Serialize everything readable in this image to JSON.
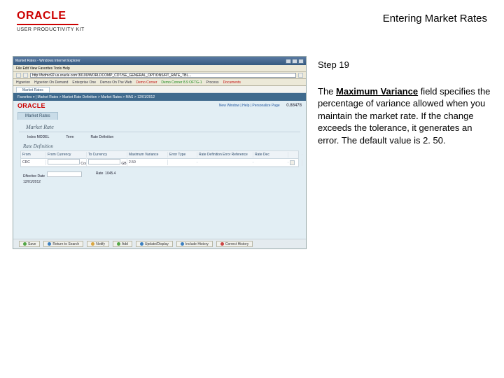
{
  "header": {
    "logo_text": "ORACLE",
    "upk_text": "USER PRODUCTIVITY KIT",
    "doc_title": "Entering Market Rates"
  },
  "info": {
    "step_label": "Step 19",
    "bold_term": "Maximum Variance",
    "text_before": "The ",
    "text_after": " field specifies the percentage of variance allowed when you maintain the market rate. If the change exceeds the tolerance, it generates an error. The default value is 2. 50."
  },
  "screenshot": {
    "window_title": "Market Rates - Windows Internet Explorer",
    "menu": "File  Edit  View  Favorites  Tools  Help",
    "address": "http://fsdmo92.us.oracle.com:30100/WORLDCOMP_CDT/SE_GENERAL_OPTIONS/RT_RATE_TBL...",
    "toolbar_items": [
      "Hyperion",
      "Hyperion On Demand",
      "Enterprise One",
      "Demos On The Web",
      "Demo Corner",
      "Demo Corner 8.9 OFTG-1",
      "Process",
      "Documents"
    ],
    "tab_label": "Market Rates",
    "crumb": "Favorites ▾ | Market Rates > Market Rate Definition > Market Rates > MAS > 12/01/2012",
    "oracle_word": "ORACLE",
    "header_links": "New Window | Help | Personalize Page",
    "top_right_val": "0.88478",
    "sub_tab": "Market Rates",
    "panel_title": "Market Rate",
    "fields": {
      "index_label": "Index",
      "index_val": "MODEL",
      "term_label": "Term",
      "term_val": "",
      "rate_type_label": "Rate Definition"
    },
    "section_title": "Rate Definition",
    "table": {
      "headers": [
        "From",
        "From Currency",
        "To Currency",
        "Maximum Variance",
        "Error Type",
        "Rate Definition Error Reference",
        "Rate Dec",
        ""
      ],
      "row": [
        "CRC",
        "Costa Ri",
        "GBP",
        "2.50",
        "",
        "",
        "",
        "▢"
      ]
    },
    "lower": {
      "eff_label": "Effective Date",
      "eff_val": "12/01/2012",
      "rate_label": "Rate",
      "rate_val": "1045.4"
    },
    "footer": [
      "Save",
      "Return to Search",
      "Notify",
      "Add",
      "Update/Display",
      "Include History",
      "Correct History"
    ]
  }
}
